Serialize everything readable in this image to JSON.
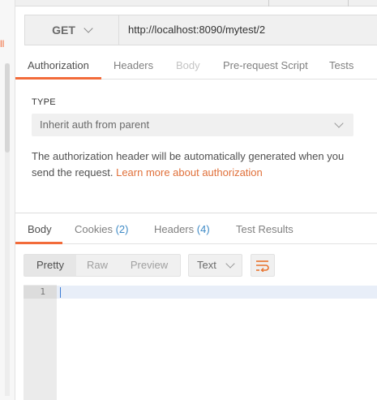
{
  "sidebar": {
    "fragment_text": "ll"
  },
  "request": {
    "method": "GET",
    "url": "http://localhost:8090/mytest/2"
  },
  "request_tabs": [
    {
      "label": "Authorization",
      "active": true
    },
    {
      "label": "Headers"
    },
    {
      "label": "Body",
      "disabled": true
    },
    {
      "label": "Pre-request Script"
    },
    {
      "label": "Tests"
    }
  ],
  "auth": {
    "type_label": "TYPE",
    "type_value": "Inherit auth from parent",
    "description": "The authorization header will be automatically generated when you send the request.",
    "link_text": "Learn more about authorization"
  },
  "response_tabs": [
    {
      "label": "Body",
      "active": true
    },
    {
      "label": "Cookies",
      "count": "(2)"
    },
    {
      "label": "Headers",
      "count": "(4)"
    },
    {
      "label": "Test Results"
    }
  ],
  "response_toolbar": {
    "view_modes": [
      "Pretty",
      "Raw",
      "Preview"
    ],
    "active_view": "Pretty",
    "format": "Text",
    "wrap_icon": "wrap-lines-icon"
  },
  "editor": {
    "line_numbers": [
      "1"
    ]
  },
  "colors": {
    "accent": "#f26b3a",
    "link": "#e0703a",
    "count": "#3e8ac6"
  }
}
